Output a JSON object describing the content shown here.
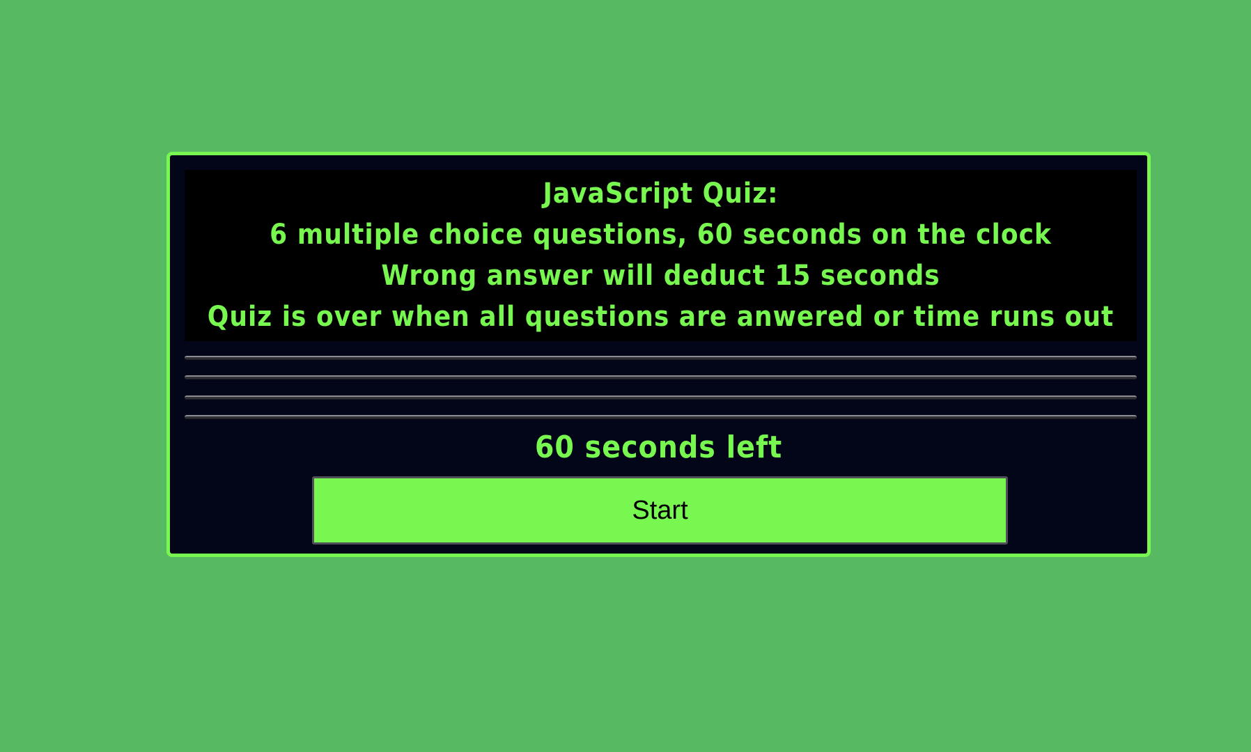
{
  "colors": {
    "background": "#57b961",
    "card": "#020618",
    "accent": "#77f74f",
    "intro_background": "#000000"
  },
  "intro": {
    "title": "JavaScript Quiz:",
    "line_1": "6 multiple choice questions, 60 seconds on the clock",
    "line_2": "Wrong answer will deduct 15 seconds",
    "line_3": "Quiz is over when all questions are anwered or time runs out"
  },
  "answers": [
    "",
    "",
    "",
    ""
  ],
  "timer": {
    "text": "60 seconds left"
  },
  "start_button": {
    "label": "Start"
  }
}
